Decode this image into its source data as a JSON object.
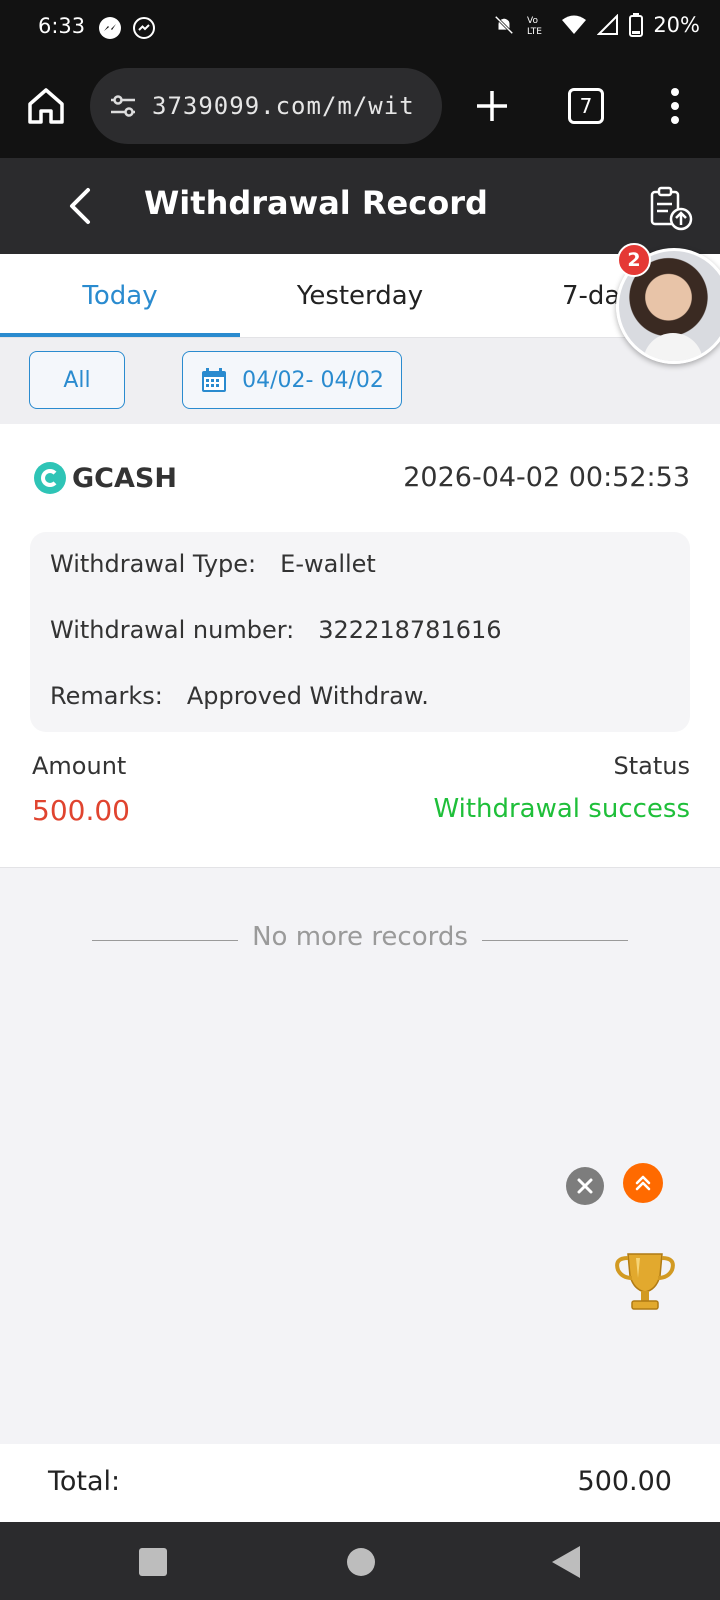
{
  "status_bar": {
    "time": "6:33",
    "battery": "20%",
    "icons": [
      "messenger-icon",
      "messenger-outline-icon",
      "mute-icon",
      "volte-icon",
      "wifi-icon",
      "signal-icon",
      "battery-icon"
    ]
  },
  "browser": {
    "url": "3739099.com/m/wit",
    "tab_count": "7"
  },
  "header": {
    "title": "Withdrawal Record"
  },
  "tabs": [
    {
      "label": "Today",
      "active": true
    },
    {
      "label": "Yesterday",
      "active": false
    },
    {
      "label": "7-da",
      "active": false
    }
  ],
  "chat_badge": "2",
  "filters": {
    "all_label": "All",
    "date_range": "04/02- 04/02"
  },
  "record": {
    "method": "GCASH",
    "datetime": "2026-04-02 00:52:53",
    "type_label": "Withdrawal Type:",
    "type_value": "E-wallet",
    "number_label": "Withdrawal number:",
    "number_value": "322218781616",
    "remarks_label": "Remarks:",
    "remarks_value": "Approved Withdraw.",
    "amount_label": "Amount",
    "amount_value": "500.00",
    "status_label": "Status",
    "status_value": "Withdrawal success"
  },
  "no_more_text": "No more records",
  "total": {
    "label": "Total:",
    "value": "500.00"
  },
  "colors": {
    "accent": "#2a8bcf",
    "amount": "#e0442f",
    "success": "#1fbf3a",
    "header_bg": "#2b2b2d"
  }
}
